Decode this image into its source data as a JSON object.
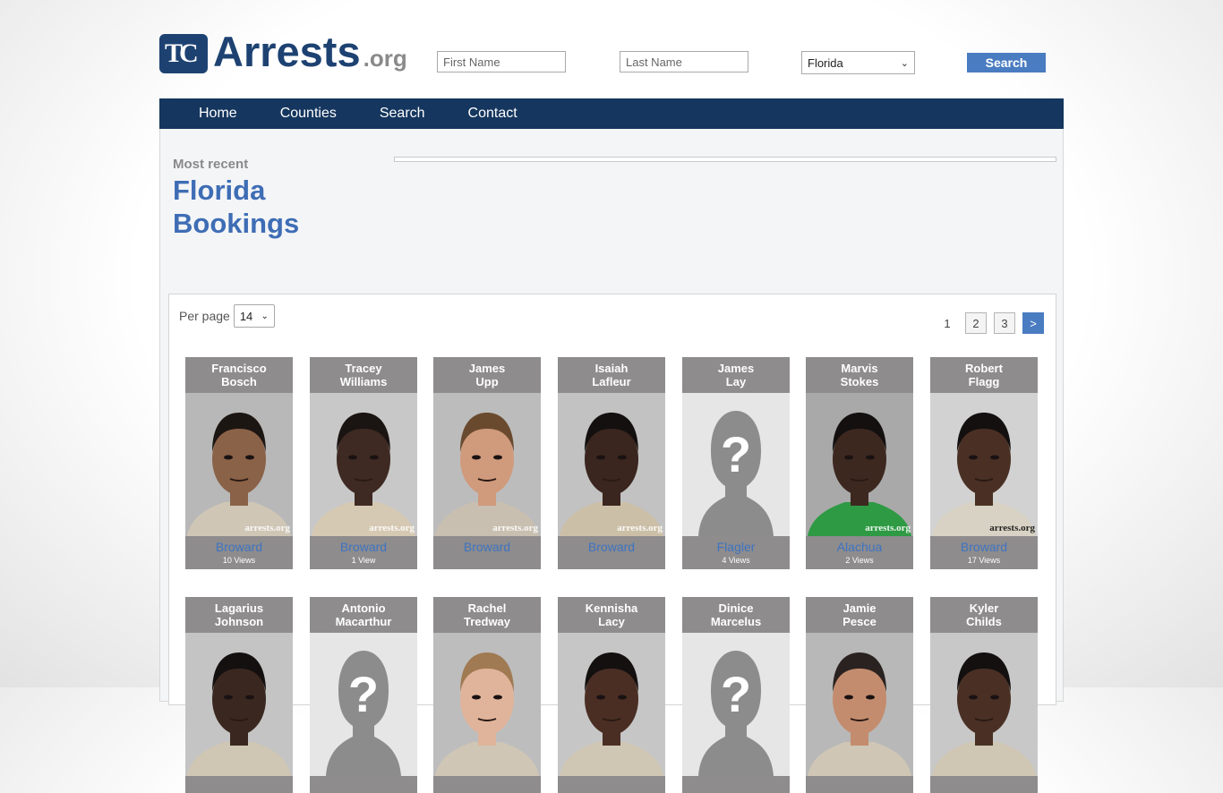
{
  "header": {
    "logo_text": "Arrests",
    "logo_suffix": ".org",
    "first_name_placeholder": "First Name",
    "last_name_placeholder": "Last Name",
    "state_selected": "Florida",
    "search_label": "Search"
  },
  "nav": {
    "items": [
      "Home",
      "Counties",
      "Search",
      "Contact"
    ]
  },
  "main": {
    "subtitle": "Most recent",
    "title_line1": "Florida",
    "title_line2": "Bookings",
    "per_page_label": "Per page",
    "per_page_value": "14",
    "pager": {
      "current": "1",
      "pages": [
        "2",
        "3"
      ],
      "next": ">"
    }
  },
  "bookings": [
    {
      "first": "Francisco",
      "last": "Bosch",
      "county": "Broward",
      "views": "10 Views",
      "photo": "portrait",
      "skin": "#8a6248",
      "bg": "#b8b8b8",
      "shirt": "#cfc6b6",
      "hair": "#1c1612"
    },
    {
      "first": "Tracey",
      "last": "Williams",
      "county": "Broward",
      "views": "1 View",
      "photo": "portrait",
      "skin": "#3e2a22",
      "bg": "#c8c8c8",
      "shirt": "#d6c9b3",
      "hair": "#1a1412"
    },
    {
      "first": "James",
      "last": "Upp",
      "county": "Broward",
      "views": "",
      "photo": "portrait",
      "skin": "#d09a7c",
      "bg": "#bcbcbc",
      "shirt": "#c8bfb0",
      "hair": "#6a4a2e"
    },
    {
      "first": "Isaiah",
      "last": "Lafleur",
      "county": "Broward",
      "views": "",
      "photo": "portrait",
      "skin": "#3a261e",
      "bg": "#c2c2c2",
      "shirt": "#ccbfa8",
      "hair": "#141010"
    },
    {
      "first": "James",
      "last": "Lay",
      "county": "Flagler",
      "views": "4 Views",
      "photo": "placeholder"
    },
    {
      "first": "Marvis",
      "last": "Stokes",
      "county": "Alachua",
      "views": "2 Views",
      "photo": "portrait",
      "skin": "#3d2820",
      "bg": "#a9a9a9",
      "shirt": "#2e9a44",
      "hair": "#141010"
    },
    {
      "first": "Robert",
      "last": "Flagg",
      "county": "Broward",
      "views": "17 Views",
      "photo": "portrait",
      "skin": "#4a3024",
      "bg": "#d2d2d2",
      "shirt": "#d8d2c4",
      "hair": "#141010"
    },
    {
      "first": "Lagarius",
      "last": "Johnson",
      "county": "",
      "views": "",
      "photo": "portrait",
      "skin": "#3a2820",
      "bg": "#c4c4c4",
      "shirt": "#d0c6b4",
      "hair": "#141010"
    },
    {
      "first": "Antonio",
      "last": "Macarthur",
      "county": "",
      "views": "",
      "photo": "placeholder"
    },
    {
      "first": "Rachel",
      "last": "Tredway",
      "county": "",
      "views": "",
      "photo": "portrait",
      "skin": "#e0b49a",
      "bg": "#bdbdbd",
      "shirt": "#cfc6b6",
      "hair": "#a07a52"
    },
    {
      "first": "Kennisha",
      "last": "Lacy",
      "county": "",
      "views": "",
      "photo": "portrait",
      "skin": "#4a2e24",
      "bg": "#c6c6c6",
      "shirt": "#d0c6b4",
      "hair": "#141010"
    },
    {
      "first": "Dinice",
      "last": "Marcelus",
      "county": "",
      "views": "",
      "photo": "placeholder"
    },
    {
      "first": "Jamie",
      "last": "Pesce",
      "county": "",
      "views": "",
      "photo": "portrait",
      "skin": "#c48c6e",
      "bg": "#b8b8b8",
      "shirt": "#cfc6b6",
      "hair": "#2a2220"
    },
    {
      "first": "Kyler",
      "last": "Childs",
      "county": "",
      "views": "",
      "photo": "portrait",
      "skin": "#4a3024",
      "bg": "#c8c8c8",
      "shirt": "#d0c6b4",
      "hair": "#141010"
    }
  ],
  "watermark": "arrests.org",
  "colors": {
    "nav_bg": "#15365e",
    "accent": "#4a7cc1",
    "link": "#3e73c2",
    "card_bg": "#8e8c8c"
  }
}
